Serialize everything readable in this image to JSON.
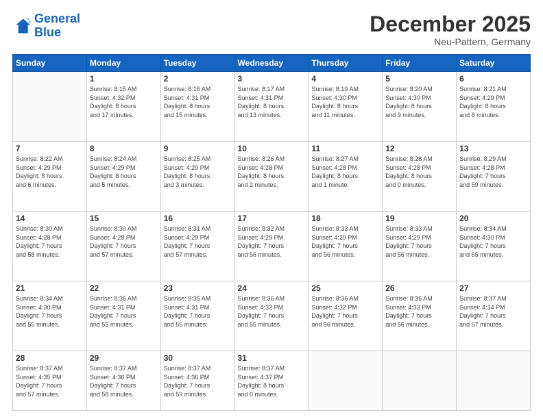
{
  "header": {
    "logo_line1": "General",
    "logo_line2": "Blue",
    "month_title": "December 2025",
    "subtitle": "Neu-Pattern, Germany"
  },
  "weekdays": [
    "Sunday",
    "Monday",
    "Tuesday",
    "Wednesday",
    "Thursday",
    "Friday",
    "Saturday"
  ],
  "weeks": [
    [
      {
        "day": "",
        "info": ""
      },
      {
        "day": "1",
        "info": "Sunrise: 8:15 AM\nSunset: 4:32 PM\nDaylight: 8 hours\nand 17 minutes."
      },
      {
        "day": "2",
        "info": "Sunrise: 8:16 AM\nSunset: 4:31 PM\nDaylight: 8 hours\nand 15 minutes."
      },
      {
        "day": "3",
        "info": "Sunrise: 8:17 AM\nSunset: 4:31 PM\nDaylight: 8 hours\nand 13 minutes."
      },
      {
        "day": "4",
        "info": "Sunrise: 8:19 AM\nSunset: 4:30 PM\nDaylight: 8 hours\nand 11 minutes."
      },
      {
        "day": "5",
        "info": "Sunrise: 8:20 AM\nSunset: 4:30 PM\nDaylight: 8 hours\nand 9 minutes."
      },
      {
        "day": "6",
        "info": "Sunrise: 8:21 AM\nSunset: 4:29 PM\nDaylight: 8 hours\nand 8 minutes."
      }
    ],
    [
      {
        "day": "7",
        "info": "Sunrise: 8:22 AM\nSunset: 4:29 PM\nDaylight: 8 hours\nand 6 minutes."
      },
      {
        "day": "8",
        "info": "Sunrise: 8:24 AM\nSunset: 4:29 PM\nDaylight: 8 hours\nand 5 minutes."
      },
      {
        "day": "9",
        "info": "Sunrise: 8:25 AM\nSunset: 4:29 PM\nDaylight: 8 hours\nand 3 minutes."
      },
      {
        "day": "10",
        "info": "Sunrise: 8:26 AM\nSunset: 4:28 PM\nDaylight: 8 hours\nand 2 minutes."
      },
      {
        "day": "11",
        "info": "Sunrise: 8:27 AM\nSunset: 4:28 PM\nDaylight: 8 hours\nand 1 minute."
      },
      {
        "day": "12",
        "info": "Sunrise: 8:28 AM\nSunset: 4:28 PM\nDaylight: 8 hours\nand 0 minutes."
      },
      {
        "day": "13",
        "info": "Sunrise: 8:29 AM\nSunset: 4:28 PM\nDaylight: 7 hours\nand 59 minutes."
      }
    ],
    [
      {
        "day": "14",
        "info": "Sunrise: 8:30 AM\nSunset: 4:28 PM\nDaylight: 7 hours\nand 58 minutes."
      },
      {
        "day": "15",
        "info": "Sunrise: 8:30 AM\nSunset: 4:28 PM\nDaylight: 7 hours\nand 57 minutes."
      },
      {
        "day": "16",
        "info": "Sunrise: 8:31 AM\nSunset: 4:29 PM\nDaylight: 7 hours\nand 57 minutes."
      },
      {
        "day": "17",
        "info": "Sunrise: 8:32 AM\nSunset: 4:29 PM\nDaylight: 7 hours\nand 56 minutes."
      },
      {
        "day": "18",
        "info": "Sunrise: 8:33 AM\nSunset: 4:29 PM\nDaylight: 7 hours\nand 56 minutes."
      },
      {
        "day": "19",
        "info": "Sunrise: 8:33 AM\nSunset: 4:29 PM\nDaylight: 7 hours\nand 56 minutes."
      },
      {
        "day": "20",
        "info": "Sunrise: 8:34 AM\nSunset: 4:30 PM\nDaylight: 7 hours\nand 55 minutes."
      }
    ],
    [
      {
        "day": "21",
        "info": "Sunrise: 8:34 AM\nSunset: 4:30 PM\nDaylight: 7 hours\nand 55 minutes."
      },
      {
        "day": "22",
        "info": "Sunrise: 8:35 AM\nSunset: 4:31 PM\nDaylight: 7 hours\nand 55 minutes."
      },
      {
        "day": "23",
        "info": "Sunrise: 8:35 AM\nSunset: 4:31 PM\nDaylight: 7 hours\nand 55 minutes."
      },
      {
        "day": "24",
        "info": "Sunrise: 8:36 AM\nSunset: 4:32 PM\nDaylight: 7 hours\nand 55 minutes."
      },
      {
        "day": "25",
        "info": "Sunrise: 8:36 AM\nSunset: 4:32 PM\nDaylight: 7 hours\nand 56 minutes."
      },
      {
        "day": "26",
        "info": "Sunrise: 8:36 AM\nSunset: 4:33 PM\nDaylight: 7 hours\nand 56 minutes."
      },
      {
        "day": "27",
        "info": "Sunrise: 8:37 AM\nSunset: 4:34 PM\nDaylight: 7 hours\nand 57 minutes."
      }
    ],
    [
      {
        "day": "28",
        "info": "Sunrise: 8:37 AM\nSunset: 4:35 PM\nDaylight: 7 hours\nand 57 minutes."
      },
      {
        "day": "29",
        "info": "Sunrise: 8:37 AM\nSunset: 4:36 PM\nDaylight: 7 hours\nand 58 minutes."
      },
      {
        "day": "30",
        "info": "Sunrise: 8:37 AM\nSunset: 4:36 PM\nDaylight: 7 hours\nand 59 minutes."
      },
      {
        "day": "31",
        "info": "Sunrise: 8:37 AM\nSunset: 4:37 PM\nDaylight: 8 hours\nand 0 minutes."
      },
      {
        "day": "",
        "info": ""
      },
      {
        "day": "",
        "info": ""
      },
      {
        "day": "",
        "info": ""
      }
    ]
  ]
}
